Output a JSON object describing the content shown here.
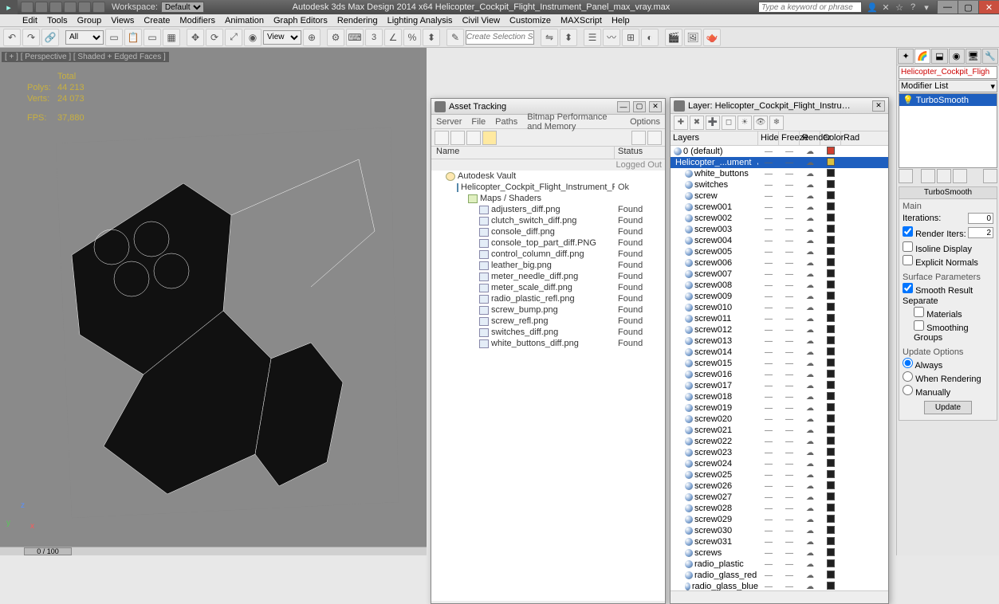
{
  "title": "Autodesk 3ds Max Design 2014 x64   Helicopter_Cockpit_Flight_Instrument_Panel_max_vray.max",
  "workspace_label": "Workspace:",
  "workspace_value": "Default",
  "search_placeholder": "Type a keyword or phrase",
  "menu": [
    "Edit",
    "Tools",
    "Group",
    "Views",
    "Create",
    "Modifiers",
    "Animation",
    "Graph Editors",
    "Rendering",
    "Lighting Analysis",
    "Civil View",
    "Customize",
    "MAXScript",
    "Help"
  ],
  "selection_filter": "All",
  "view_filter": "View",
  "create_sel_set": "Create Selection Se",
  "ref_coord_num": "3",
  "viewport": {
    "label": "[ + ] [ Perspective ] [ Shaded + Edged Faces ]",
    "stats": {
      "total_label": "Total",
      "polys_label": "Polys:",
      "polys": "44 213",
      "verts_label": "Verts:",
      "verts": "24 073",
      "fps_label": "FPS:",
      "fps": "37,880"
    }
  },
  "time_slider": "0 / 100",
  "asset_panel": {
    "title": "Asset Tracking",
    "menus": [
      "Server",
      "File",
      "Paths",
      "Bitmap Performance and Memory",
      "Options"
    ],
    "col_name": "Name",
    "col_status": "Status",
    "rows": [
      {
        "indent": 1,
        "icon": "vault",
        "name": "Autodesk Vault",
        "status": ""
      },
      {
        "indent": 2,
        "icon": "max",
        "name": "Helicopter_Cockpit_Flight_Instrument_Panel_m...",
        "status": "Ok"
      },
      {
        "indent": 3,
        "icon": "folder",
        "name": "Maps / Shaders",
        "status": ""
      },
      {
        "indent": 4,
        "icon": "img",
        "name": "adjusters_diff.png",
        "status": "Found"
      },
      {
        "indent": 4,
        "icon": "img",
        "name": "clutch_switch_diff.png",
        "status": "Found"
      },
      {
        "indent": 4,
        "icon": "img",
        "name": "console_diff.png",
        "status": "Found"
      },
      {
        "indent": 4,
        "icon": "img",
        "name": "console_top_part_diff.PNG",
        "status": "Found"
      },
      {
        "indent": 4,
        "icon": "img",
        "name": "control_column_diff.png",
        "status": "Found"
      },
      {
        "indent": 4,
        "icon": "img",
        "name": "leather_big.png",
        "status": "Found"
      },
      {
        "indent": 4,
        "icon": "img",
        "name": "meter_needle_diff.png",
        "status": "Found"
      },
      {
        "indent": 4,
        "icon": "img",
        "name": "meter_scale_diff.png",
        "status": "Found"
      },
      {
        "indent": 4,
        "icon": "img",
        "name": "radio_plastic_refl.png",
        "status": "Found"
      },
      {
        "indent": 4,
        "icon": "img",
        "name": "screw_bump.png",
        "status": "Found"
      },
      {
        "indent": 4,
        "icon": "img",
        "name": "screw_refl.png",
        "status": "Found"
      },
      {
        "indent": 4,
        "icon": "img",
        "name": "switches_diff.png",
        "status": "Found"
      },
      {
        "indent": 4,
        "icon": "img",
        "name": "white_buttons_diff.png",
        "status": "Found"
      }
    ],
    "logged_out": "Logged Out"
  },
  "layer_panel": {
    "title": "Layer: Helicopter_Cockpit_Flight_Instrument_Panel",
    "cols": {
      "layers": "Layers",
      "hide": "Hide",
      "freeze": "Freeze",
      "render": "Render",
      "color": "Color",
      "rad": "Rad"
    },
    "layers": [
      {
        "name": "0 (default)",
        "depth": 0,
        "selected": false,
        "checked": false,
        "color": "#d04030"
      },
      {
        "name": "Helicopter_...ument",
        "depth": 0,
        "selected": true,
        "checked": true,
        "color": "#d9c040"
      },
      {
        "name": "white_buttons",
        "depth": 1,
        "selected": false,
        "checked": false,
        "color": "#202020"
      },
      {
        "name": "switches",
        "depth": 1,
        "selected": false,
        "checked": false,
        "color": "#202020"
      },
      {
        "name": "screw",
        "depth": 1,
        "selected": false,
        "checked": false,
        "color": "#202020"
      },
      {
        "name": "screw001",
        "depth": 1,
        "selected": false,
        "checked": false,
        "color": "#202020"
      },
      {
        "name": "screw002",
        "depth": 1,
        "selected": false,
        "checked": false,
        "color": "#202020"
      },
      {
        "name": "screw003",
        "depth": 1,
        "selected": false,
        "checked": false,
        "color": "#202020"
      },
      {
        "name": "screw004",
        "depth": 1,
        "selected": false,
        "checked": false,
        "color": "#202020"
      },
      {
        "name": "screw005",
        "depth": 1,
        "selected": false,
        "checked": false,
        "color": "#202020"
      },
      {
        "name": "screw006",
        "depth": 1,
        "selected": false,
        "checked": false,
        "color": "#202020"
      },
      {
        "name": "screw007",
        "depth": 1,
        "selected": false,
        "checked": false,
        "color": "#202020"
      },
      {
        "name": "screw008",
        "depth": 1,
        "selected": false,
        "checked": false,
        "color": "#202020"
      },
      {
        "name": "screw009",
        "depth": 1,
        "selected": false,
        "checked": false,
        "color": "#202020"
      },
      {
        "name": "screw010",
        "depth": 1,
        "selected": false,
        "checked": false,
        "color": "#202020"
      },
      {
        "name": "screw011",
        "depth": 1,
        "selected": false,
        "checked": false,
        "color": "#202020"
      },
      {
        "name": "screw012",
        "depth": 1,
        "selected": false,
        "checked": false,
        "color": "#202020"
      },
      {
        "name": "screw013",
        "depth": 1,
        "selected": false,
        "checked": false,
        "color": "#202020"
      },
      {
        "name": "screw014",
        "depth": 1,
        "selected": false,
        "checked": false,
        "color": "#202020"
      },
      {
        "name": "screw015",
        "depth": 1,
        "selected": false,
        "checked": false,
        "color": "#202020"
      },
      {
        "name": "screw016",
        "depth": 1,
        "selected": false,
        "checked": false,
        "color": "#202020"
      },
      {
        "name": "screw017",
        "depth": 1,
        "selected": false,
        "checked": false,
        "color": "#202020"
      },
      {
        "name": "screw018",
        "depth": 1,
        "selected": false,
        "checked": false,
        "color": "#202020"
      },
      {
        "name": "screw019",
        "depth": 1,
        "selected": false,
        "checked": false,
        "color": "#202020"
      },
      {
        "name": "screw020",
        "depth": 1,
        "selected": false,
        "checked": false,
        "color": "#202020"
      },
      {
        "name": "screw021",
        "depth": 1,
        "selected": false,
        "checked": false,
        "color": "#202020"
      },
      {
        "name": "screw022",
        "depth": 1,
        "selected": false,
        "checked": false,
        "color": "#202020"
      },
      {
        "name": "screw023",
        "depth": 1,
        "selected": false,
        "checked": false,
        "color": "#202020"
      },
      {
        "name": "screw024",
        "depth": 1,
        "selected": false,
        "checked": false,
        "color": "#202020"
      },
      {
        "name": "screw025",
        "depth": 1,
        "selected": false,
        "checked": false,
        "color": "#202020"
      },
      {
        "name": "screw026",
        "depth": 1,
        "selected": false,
        "checked": false,
        "color": "#202020"
      },
      {
        "name": "screw027",
        "depth": 1,
        "selected": false,
        "checked": false,
        "color": "#202020"
      },
      {
        "name": "screw028",
        "depth": 1,
        "selected": false,
        "checked": false,
        "color": "#202020"
      },
      {
        "name": "screw029",
        "depth": 1,
        "selected": false,
        "checked": false,
        "color": "#202020"
      },
      {
        "name": "screw030",
        "depth": 1,
        "selected": false,
        "checked": false,
        "color": "#202020"
      },
      {
        "name": "screw031",
        "depth": 1,
        "selected": false,
        "checked": false,
        "color": "#202020"
      },
      {
        "name": "screws",
        "depth": 1,
        "selected": false,
        "checked": false,
        "color": "#202020"
      },
      {
        "name": "radio_plastic",
        "depth": 1,
        "selected": false,
        "checked": false,
        "color": "#202020"
      },
      {
        "name": "radio_glass_red",
        "depth": 1,
        "selected": false,
        "checked": false,
        "color": "#202020"
      },
      {
        "name": "radio_glass_blue",
        "depth": 1,
        "selected": false,
        "checked": false,
        "color": "#202020"
      }
    ]
  },
  "cmd": {
    "obj_name": "Helicopter_Cockpit_Fligh",
    "modifier_list_label": "Modifier List",
    "stack_item": "TurboSmooth",
    "rollout": {
      "title": "TurboSmooth",
      "sections": {
        "main": "Main",
        "iterations": "Iterations:",
        "iterations_val": "0",
        "render_iters": "Render Iters:",
        "render_iters_val": "2",
        "isoline": "Isoline Display",
        "explicit": "Explicit Normals",
        "surface_params": "Surface Parameters",
        "smooth_result": "Smooth Result",
        "separate": "Separate",
        "materials": "Materials",
        "smoothing_groups": "Smoothing Groups",
        "update_options": "Update Options",
        "always": "Always",
        "when_rendering": "When Rendering",
        "manually": "Manually",
        "update_btn": "Update"
      }
    }
  }
}
